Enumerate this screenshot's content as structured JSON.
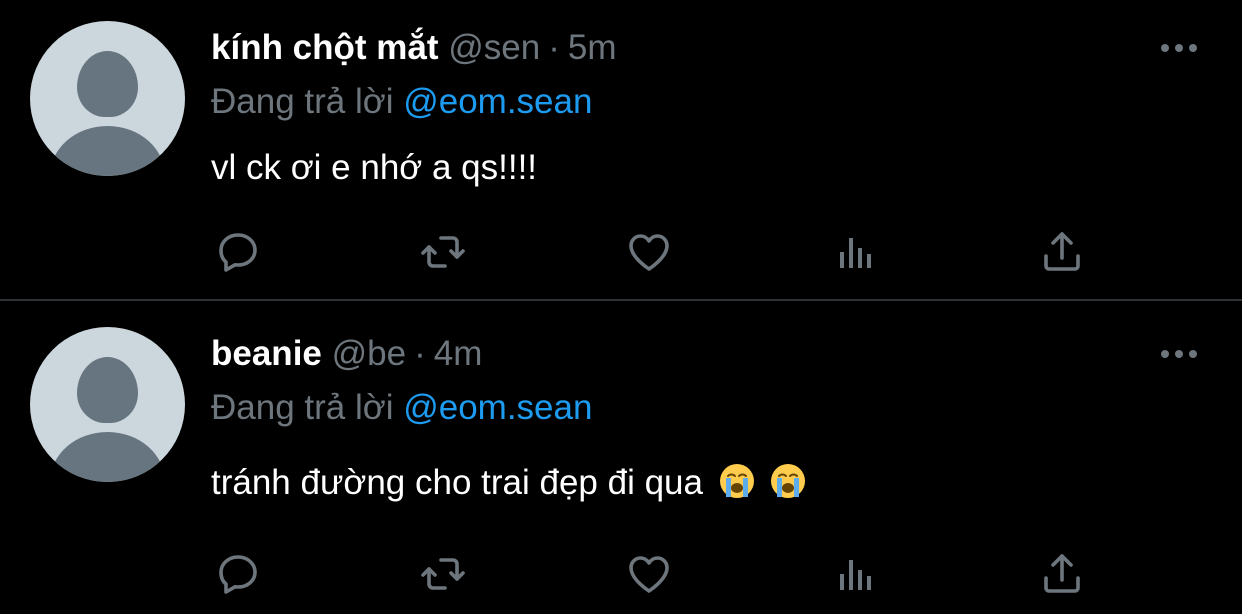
{
  "colors": {
    "background": "#000000",
    "text_primary": "#ffffff",
    "text_secondary": "#6e767d",
    "mention": "#1d9bf0",
    "divider": "#2f3336",
    "avatar_bg": "#ccd6dd",
    "avatar_fg": "#66757f"
  },
  "tweets": [
    {
      "display_name": "kính chột mắt",
      "handle": "@sen",
      "separator": "·",
      "time": "5m",
      "reply_prefix": "Đang trả lời",
      "reply_to": "@eom.sean",
      "text": "vl ck ơi e nhớ a qs!!!!",
      "emojis": [],
      "actions": [
        "reply-icon",
        "retweet-icon",
        "like-icon",
        "stats-icon",
        "share-icon"
      ]
    },
    {
      "display_name": "beanie",
      "handle": "@be",
      "separator": "·",
      "time": "4m",
      "reply_prefix": "Đang trả lời",
      "reply_to": "@eom.sean",
      "text": "tránh đường cho trai đẹp đi qua",
      "emojis": [
        "loudly-crying-face",
        "loudly-crying-face"
      ],
      "actions": [
        "reply-icon",
        "retweet-icon",
        "like-icon",
        "stats-icon",
        "share-icon"
      ]
    }
  ]
}
